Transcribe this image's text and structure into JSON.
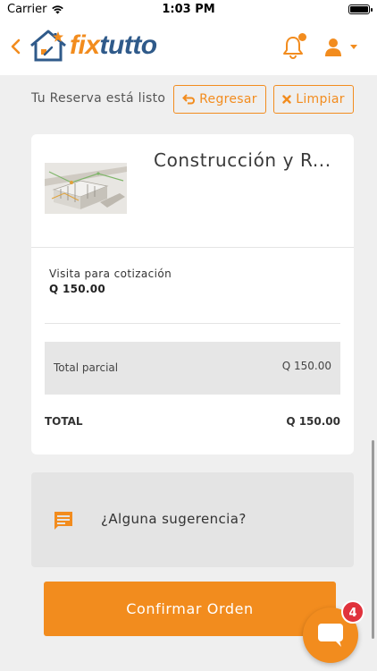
{
  "status_bar": {
    "carrier": "Carrier",
    "time": "1:03 PM"
  },
  "header": {
    "logo_fix": "fix",
    "logo_tutto": "tutto",
    "has_notification_dot": true
  },
  "toolbar": {
    "status_text": "Tu Reserva está listo",
    "back_label": "Regresar",
    "clear_label": "Limpiar"
  },
  "cart": {
    "service_title": "Construcción y R...",
    "item": {
      "name": "Visita para cotización",
      "price": "Q 150.00"
    },
    "subtotal_label": "Total parcial",
    "subtotal_value": "Q 150.00",
    "total_label": "TOTAL",
    "total_value": "Q 150.00"
  },
  "suggestions": {
    "prompt": "¿Alguna sugerencia?"
  },
  "confirm_label": "Confirmar Orden",
  "chat": {
    "badge_count": "4"
  },
  "colors": {
    "accent": "#f28c1e",
    "brand_blue": "#2f5a8a",
    "badge_red": "#e0323c",
    "background": "#efefef"
  }
}
